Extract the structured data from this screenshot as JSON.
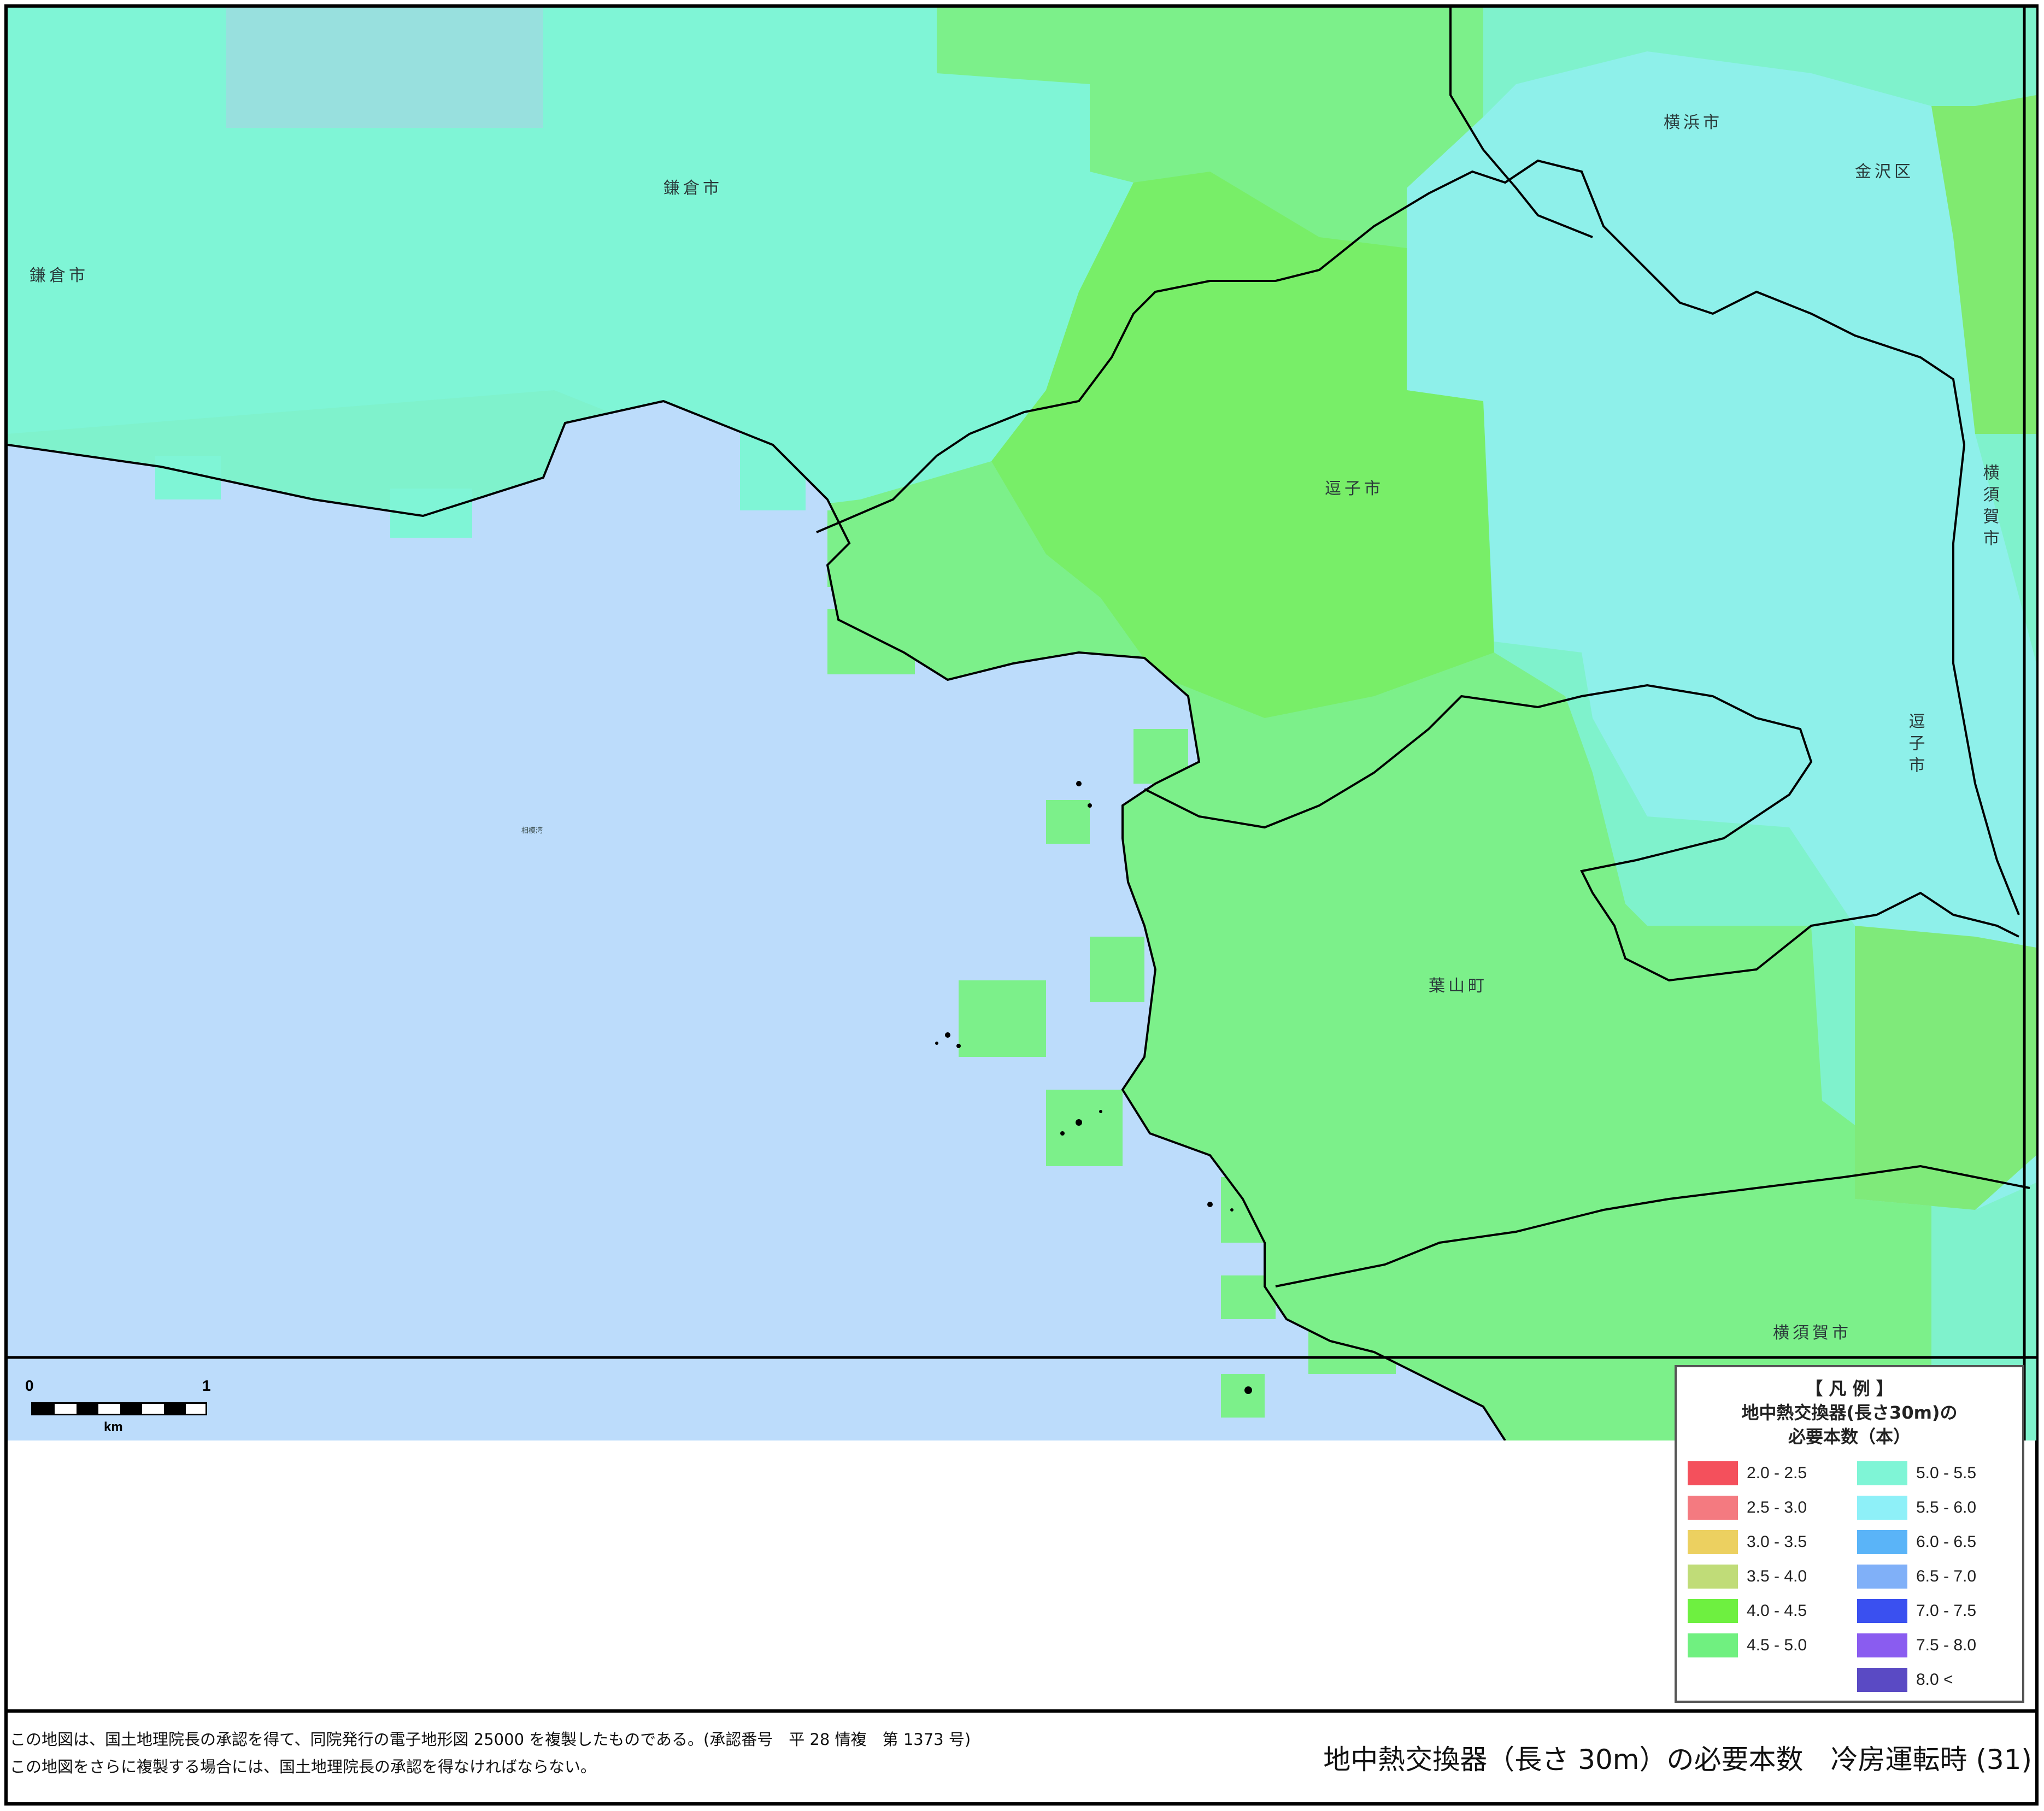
{
  "map": {
    "sea_label": "相模湾",
    "places": {
      "kamakura_center": "鎌倉市",
      "kamakura_west": "鎌倉市",
      "zushi_center": "逗子市",
      "zushi_east": "逗子市",
      "hayama": "葉山町",
      "yokohama": "横浜市",
      "kanazawa": "金沢区",
      "yokosuka_east": "横須賀市",
      "yokosuka_south": "横須賀市"
    },
    "colors": {
      "sea": "#bcdcfb",
      "class_5_0_5_5": "#7ff5d6",
      "class_5_5_6_0": "#8ff0f5",
      "class_4_5_5_0": "#77f07a",
      "class_4_0_4_5": "#7dea5a",
      "boundary": "#000000"
    }
  },
  "scale": {
    "zero": "0",
    "one": "1",
    "unit": "km"
  },
  "legend": {
    "heading": "【 凡 例 】",
    "title_line1": "地中熱交換器(長さ30m)の",
    "title_line2": "必要本数（本）",
    "items": [
      {
        "label": "2.0  -  2.5",
        "color": "#f4505c"
      },
      {
        "label": "2.5  -  3.0",
        "color": "#f47a80"
      },
      {
        "label": "3.0  -  3.5",
        "color": "#ecd060"
      },
      {
        "label": "3.5  -  4.0",
        "color": "#c0dc78"
      },
      {
        "label": "4.0  -  4.5",
        "color": "#6ef040"
      },
      {
        "label": "4.5  -  5.0",
        "color": "#70f080"
      },
      {
        "label": "5.0  -  5.5",
        "color": "#7ff5d6"
      },
      {
        "label": "5.5  -  6.0",
        "color": "#8ef0f8"
      },
      {
        "label": "6.0  -  6.5",
        "color": "#5ab4f8"
      },
      {
        "label": "6.5  -  7.0",
        "color": "#80b0f8"
      },
      {
        "label": "7.0  -  7.5",
        "color": "#3a50f0"
      },
      {
        "label": "7.5  -  8.0",
        "color": "#8a5cf0"
      },
      {
        "label": "8.0 <",
        "color": "#5a4ac4"
      }
    ]
  },
  "footer": {
    "note_line1": "この地図は、国土地理院長の承認を得て、同院発行の電子地形図 25000 を複製したものである。(承認番号　平 28 情複　第 1373 号)",
    "note_line2": "この地図をさらに複製する場合には、国土地理院長の承認を得なければならない。",
    "caption": "地中熱交換器（長さ 30m）の必要本数　冷房運転時 (31)"
  }
}
